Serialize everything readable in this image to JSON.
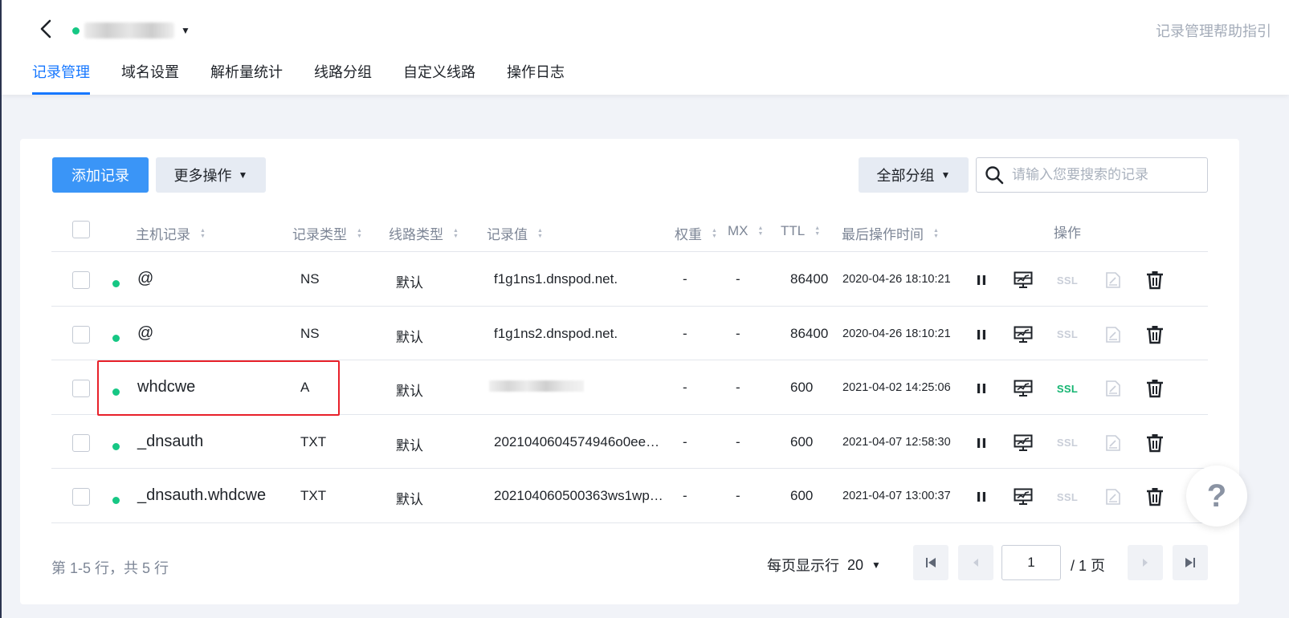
{
  "header": {
    "help_link": "记录管理帮助指引",
    "tabs": [
      {
        "label": "记录管理",
        "active": true
      },
      {
        "label": "域名设置",
        "active": false
      },
      {
        "label": "解析量统计",
        "active": false
      },
      {
        "label": "线路分组",
        "active": false
      },
      {
        "label": "自定义线路",
        "active": false
      },
      {
        "label": "操作日志",
        "active": false
      }
    ]
  },
  "toolbar": {
    "add_label": "添加记录",
    "more_label": "更多操作",
    "group_label": "全部分组",
    "search_placeholder": "请输入您要搜索的记录"
  },
  "table": {
    "columns": {
      "host": "主机记录",
      "type": "记录类型",
      "line": "线路类型",
      "value": "记录值",
      "weight": "权重",
      "mx": "MX",
      "ttl": "TTL",
      "time": "最后操作时间",
      "actions": "操作"
    },
    "rows": [
      {
        "host": "@",
        "type": "NS",
        "line": "默认",
        "value": "f1g1ns1.dnspod.net.",
        "weight": "-",
        "mx": "-",
        "ttl": "86400",
        "time": "2020-04-26 18:10:21",
        "ssl": "SSL",
        "ssl_enabled": false
      },
      {
        "host": "@",
        "type": "NS",
        "line": "默认",
        "value": "f1g1ns2.dnspod.net.",
        "weight": "-",
        "mx": "-",
        "ttl": "86400",
        "time": "2020-04-26 18:10:21",
        "ssl": "SSL",
        "ssl_enabled": false
      },
      {
        "host": "whdcwe",
        "type": "A",
        "line": "默认",
        "value": "",
        "weight": "-",
        "mx": "-",
        "ttl": "600",
        "time": "2021-04-02 14:25:06",
        "ssl": "SSL",
        "ssl_enabled": true
      },
      {
        "host": "_dnsauth",
        "type": "TXT",
        "line": "默认",
        "value": "2021040604574946o0eezx...",
        "weight": "-",
        "mx": "-",
        "ttl": "600",
        "time": "2021-04-07 12:58:30",
        "ssl": "SSL",
        "ssl_enabled": false
      },
      {
        "host": "_dnsauth.whdcwe",
        "type": "TXT",
        "line": "默认",
        "value": "202104060500363ws1wp6...",
        "weight": "-",
        "mx": "-",
        "ttl": "600",
        "time": "2021-04-07 13:00:37",
        "ssl": "SSL",
        "ssl_enabled": false
      }
    ]
  },
  "footer": {
    "summary": "第 1-5 行，共 5 行",
    "per_page_label": "每页显示行",
    "per_page_value": "20",
    "current_page": "1",
    "total_pages": "/ 1 页"
  },
  "help_float": "?",
  "colors": {
    "accent": "#1677ff",
    "primary_button": "#3a95f7",
    "status_green": "#16c784",
    "ssl_green": "#13b470",
    "highlight_red": "#e8212a"
  }
}
